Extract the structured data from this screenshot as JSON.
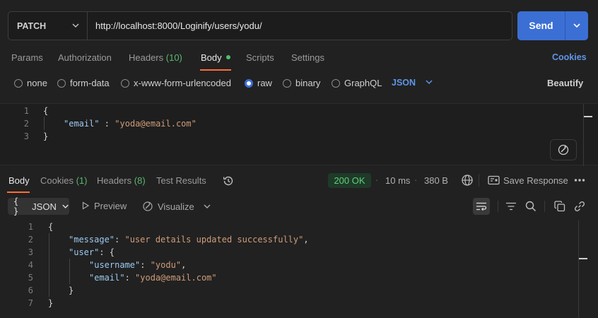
{
  "request": {
    "method": "PATCH",
    "url": "http://localhost:8000/Loginify/users/yodu/",
    "send_label": "Send"
  },
  "request_tabs": {
    "params": "Params",
    "authorization": "Authorization",
    "headers": "Headers",
    "headers_count": "(10)",
    "body": "Body",
    "scripts": "Scripts",
    "settings": "Settings",
    "cookies": "Cookies"
  },
  "body_types": {
    "none": "none",
    "form_data": "form-data",
    "urlencoded": "x-www-form-urlencoded",
    "raw": "raw",
    "binary": "binary",
    "graphql": "GraphQL",
    "format": "JSON",
    "beautify": "Beautify"
  },
  "request_body": {
    "lines": [
      {
        "num": "1",
        "open": "{"
      },
      {
        "num": "2",
        "key": "\"email\"",
        "sep": " : ",
        "value": "\"yoda@email.com\""
      },
      {
        "num": "3",
        "close": "}"
      }
    ]
  },
  "response_tabs": {
    "body": "Body",
    "cookies": "Cookies",
    "cookies_count": "(1)",
    "headers": "Headers",
    "headers_count": "(8)",
    "test_results": "Test Results"
  },
  "response_meta": {
    "status": "200 OK",
    "time": "10 ms",
    "size": "380 B",
    "save_response": "Save Response"
  },
  "response_toolbar": {
    "format": "JSON",
    "format_braces": "{ }",
    "preview": "Preview",
    "visualize": "Visualize"
  },
  "response_body": {
    "n1": "1",
    "n2": "2",
    "n3": "3",
    "n4": "4",
    "n5": "5",
    "n6": "6",
    "n7": "7",
    "open": "{",
    "message_key": "\"message\"",
    "message_value": "\"user details updated successfully\"",
    "user_key": "\"user\"",
    "username_key": "\"username\"",
    "username_value": "\"yodu\"",
    "email_key": "\"email\"",
    "email_value": "\"yoda@email.com\"",
    "inner_close": "}",
    "close": "}"
  },
  "colors": {
    "accent_orange": "#ff6c37",
    "send_blue": "#3b6fd4",
    "status_green": "#5fd07b"
  }
}
